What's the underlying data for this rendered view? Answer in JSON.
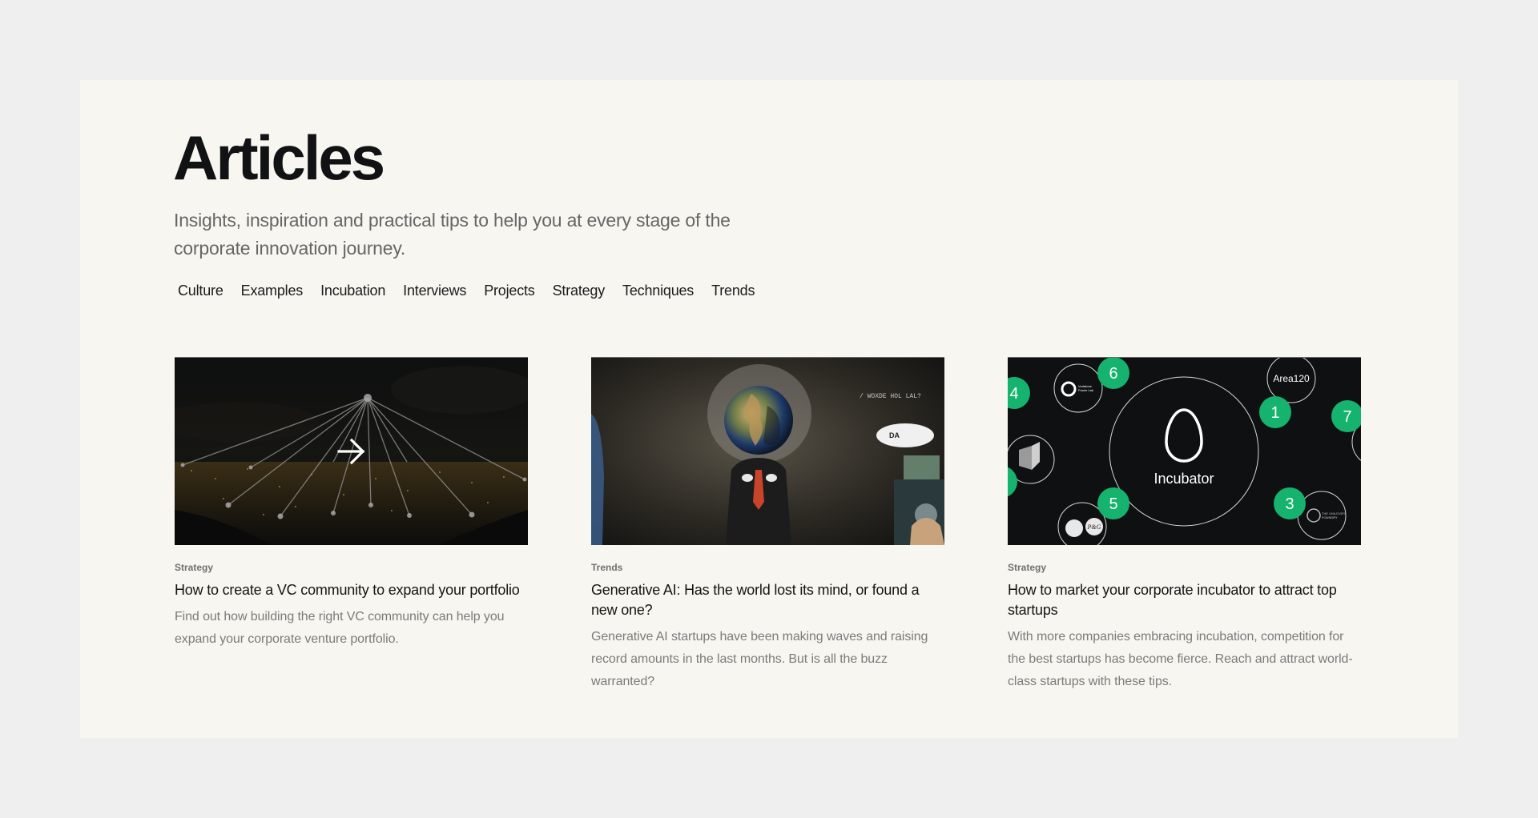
{
  "header": {
    "title": "Articles",
    "subtitle": "Insights, inspiration and practical tips to help you at every stage of the corporate innovation journey."
  },
  "tags": [
    {
      "label": "Culture"
    },
    {
      "label": "Examples"
    },
    {
      "label": "Incubation"
    },
    {
      "label": "Interviews"
    },
    {
      "label": "Projects"
    },
    {
      "label": "Strategy"
    },
    {
      "label": "Techniques"
    },
    {
      "label": "Trends"
    }
  ],
  "articles": [
    {
      "category": "Strategy",
      "title": "How to create a VC community to expand your portfolio",
      "description": "Find out how building the right VC community can help you expand your corporate venture portfolio.",
      "image": "network-over-city-skyline",
      "overlay_icon": "arrow-right-icon"
    },
    {
      "category": "Trends",
      "title": "Generative AI: Has the world lost its mind, or found a new one?",
      "description": "Generative AI startups have been making waves and raising record amounts in the last months. But is all the buzz warranted?",
      "image": "man-with-globe-head",
      "image_text": "/ WOXDE HOL LAL?",
      "speech_bubble": "DA"
    },
    {
      "category": "Strategy",
      "title": "How to market your corporate incubator to attract top startups",
      "description": "With more companies embracing incubation, competition for the best startups has become fierce. Reach and attract world-class startups with these tips.",
      "image": "incubator-diagram",
      "diagram": {
        "center_label": "Incubator",
        "badges": [
          "1",
          "3",
          "4",
          "5",
          "6",
          "7"
        ],
        "logos": [
          "Area120",
          "Vodafone Power Lab",
          "P&G",
          "The Unilever Foundry"
        ],
        "accent_color": "#16b36e"
      }
    }
  ]
}
